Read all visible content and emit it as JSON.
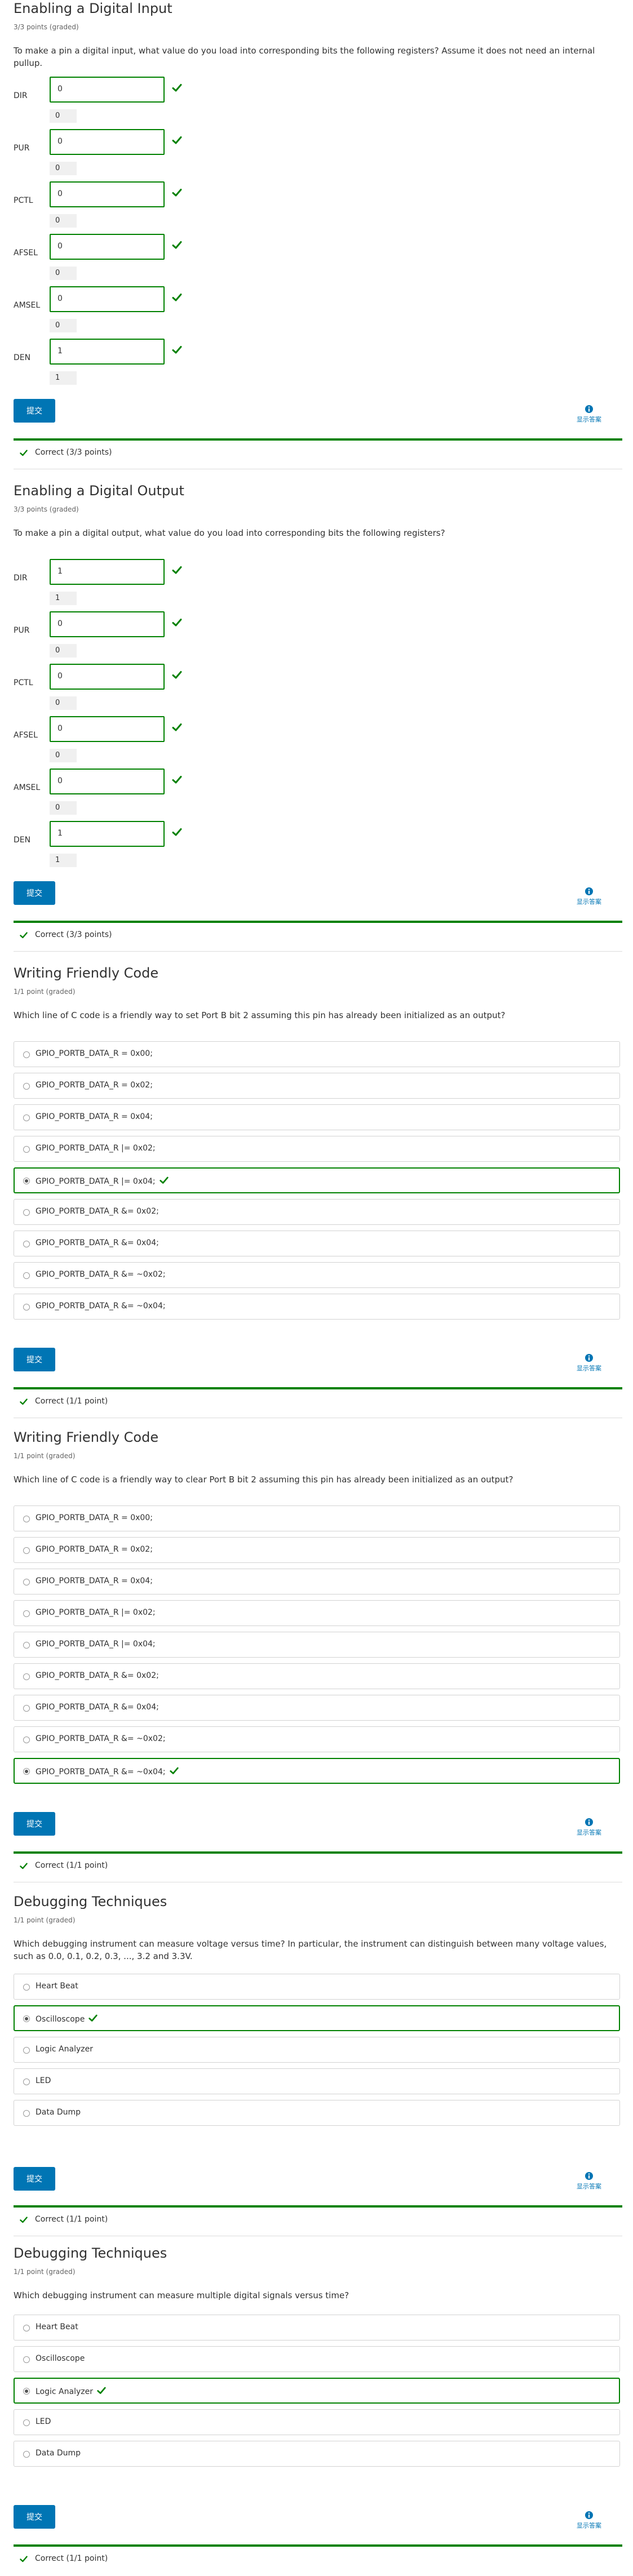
{
  "problems": [
    {
      "title": "Enabling a Digital Input",
      "points": "3/3 points (graded)",
      "question": "To make a pin a digital input, what value do you load into corresponding bits the following registers? Assume it does not need an internal pullup.",
      "fields": [
        {
          "label": "DIR",
          "value": "0",
          "echo": "0"
        },
        {
          "label": "PUR",
          "value": "0",
          "echo": "0"
        },
        {
          "label": "PCTL",
          "value": "0",
          "echo": "0"
        },
        {
          "label": "AFSEL",
          "value": "0",
          "echo": "0"
        },
        {
          "label": "AMSEL",
          "value": "0",
          "echo": "0"
        },
        {
          "label": "DEN",
          "value": "1",
          "echo": "1"
        }
      ],
      "submit": "提交",
      "hint": "显示答案",
      "status": "Correct (3/3 points)"
    },
    {
      "title": "Enabling a Digital Output",
      "points": "3/3 points (graded)",
      "question": "To make a pin a digital output, what value do you load into corresponding bits the following registers?",
      "fields": [
        {
          "label": "DIR",
          "value": "1",
          "echo": "1"
        },
        {
          "label": "PUR",
          "value": "0",
          "echo": "0"
        },
        {
          "label": "PCTL",
          "value": "0",
          "echo": "0"
        },
        {
          "label": "AFSEL",
          "value": "0",
          "echo": "0"
        },
        {
          "label": "AMSEL",
          "value": "0",
          "echo": "0"
        },
        {
          "label": "DEN",
          "value": "1",
          "echo": "1"
        }
      ],
      "submit": "提交",
      "hint": "显示答案",
      "status": "Correct (3/3 points)"
    },
    {
      "title": "Writing Friendly Code",
      "points": "1/1 point (graded)",
      "question": "Which line of C code is a friendly way to set Port B bit 2 assuming this pin has already been initialized as an output?",
      "options": [
        "GPIO_PORTB_DATA_R = 0x00;",
        "GPIO_PORTB_DATA_R = 0x02;",
        "GPIO_PORTB_DATA_R = 0x04;",
        "GPIO_PORTB_DATA_R |= 0x02;",
        "GPIO_PORTB_DATA_R |= 0x04;",
        "GPIO_PORTB_DATA_R &= 0x02;",
        "GPIO_PORTB_DATA_R &= 0x04;",
        "GPIO_PORTB_DATA_R &= ~0x02;",
        "GPIO_PORTB_DATA_R &= ~0x04;"
      ],
      "selected": 4,
      "submit": "提交",
      "hint": "显示答案",
      "status": "Correct (1/1 point)"
    },
    {
      "title": "Writing Friendly Code",
      "points": "1/1 point (graded)",
      "question": "Which line of C code is a friendly way to clear Port B bit 2 assuming this pin has already been initialized as an output?",
      "options": [
        "GPIO_PORTB_DATA_R = 0x00;",
        "GPIO_PORTB_DATA_R = 0x02;",
        "GPIO_PORTB_DATA_R = 0x04;",
        "GPIO_PORTB_DATA_R |= 0x02;",
        "GPIO_PORTB_DATA_R |= 0x04;",
        "GPIO_PORTB_DATA_R &= 0x02;",
        "GPIO_PORTB_DATA_R &= 0x04;",
        "GPIO_PORTB_DATA_R &= ~0x02;",
        "GPIO_PORTB_DATA_R &= ~0x04;"
      ],
      "selected": 8,
      "submit": "提交",
      "hint": "显示答案",
      "status": "Correct (1/1 point)"
    },
    {
      "title": "Debugging Techniques",
      "points": "1/1 point (graded)",
      "question": "Which debugging instrument can measure voltage versus time? In particular, the instrument can distinguish between many voltage values, such as 0.0, 0.1, 0.2, 0.3, ..., 3.2 and 3.3V.",
      "options": [
        "Heart Beat",
        "Oscilloscope",
        "Logic Analyzer",
        "LED",
        "Data Dump"
      ],
      "selected": 1,
      "submit": "提交",
      "hint": "显示答案",
      "status": "Correct (1/1 point)"
    },
    {
      "title": "Debugging Techniques",
      "points": "1/1 point (graded)",
      "question": "Which debugging instrument can measure multiple digital signals versus time?",
      "options": [
        "Heart Beat",
        "Oscilloscope",
        "Logic Analyzer",
        "LED",
        "Data Dump"
      ],
      "selected": 2,
      "submit": "提交",
      "hint": "显示答案",
      "status": "Correct (1/1 point)"
    }
  ],
  "colors": {
    "correct": "#008100",
    "submit_bg": "#0075b4",
    "hint_link": "#0075b4",
    "border": "#d2d2d2"
  },
  "icons": {
    "correct": "check-icon",
    "hint": "info-circle-icon",
    "radio": "radio-icon"
  }
}
